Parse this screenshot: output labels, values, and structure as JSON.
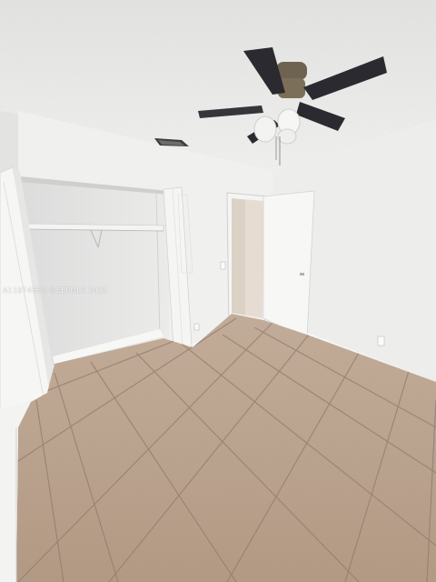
{
  "watermark": "A11974630 ©SEFMLS 2025",
  "colors": {
    "ceiling": "#ececeb",
    "wall_left": "#e9e9e8",
    "wall_back": "#f1f1f0",
    "wall_right": "#eeeeed",
    "floor_tile": "#b59c86",
    "grout": "#8f7a68",
    "door": "#f6f6f4",
    "fan_blade": "#2a2a30",
    "fan_metal": "#6e6350"
  },
  "icons": {
    "fan": "ceiling-fan-icon",
    "vent": "ceiling-vent-icon"
  }
}
